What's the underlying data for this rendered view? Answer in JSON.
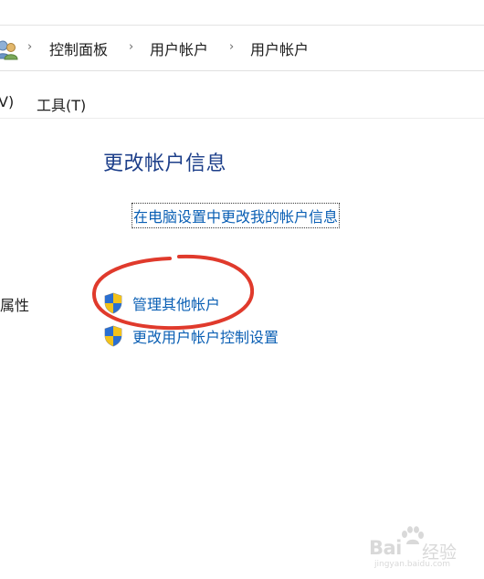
{
  "address_bar": {
    "breadcrumbs": [
      "控制面板",
      "用户帐户",
      "用户帐户"
    ],
    "separator": "›",
    "icon": "user-accounts-icon"
  },
  "menu_bar": {
    "items": [
      "V)",
      "工具(T)"
    ]
  },
  "main": {
    "section_title": "更改帐户信息",
    "pc_settings_link": "在电脑设置中更改我的帐户信息",
    "left_label": "属性",
    "tasks": [
      {
        "label": "管理其他帐户",
        "icon": "uac-shield-icon"
      },
      {
        "label": "更改用户帐户控制设置",
        "icon": "uac-shield-icon"
      }
    ]
  },
  "annotation": {
    "shape": "ellipse",
    "color": "#e03a2c"
  },
  "watermark": {
    "brand": "Bai",
    "brand_tail": "经验",
    "url": "jingyan.baidu.com"
  },
  "colors": {
    "title_blue": "#1d3f8a",
    "link_blue": "#0a5fb4",
    "text": "#1e1e1e",
    "annotation_red": "#e03a2c",
    "watermark_gray": "#d9d9d9"
  }
}
